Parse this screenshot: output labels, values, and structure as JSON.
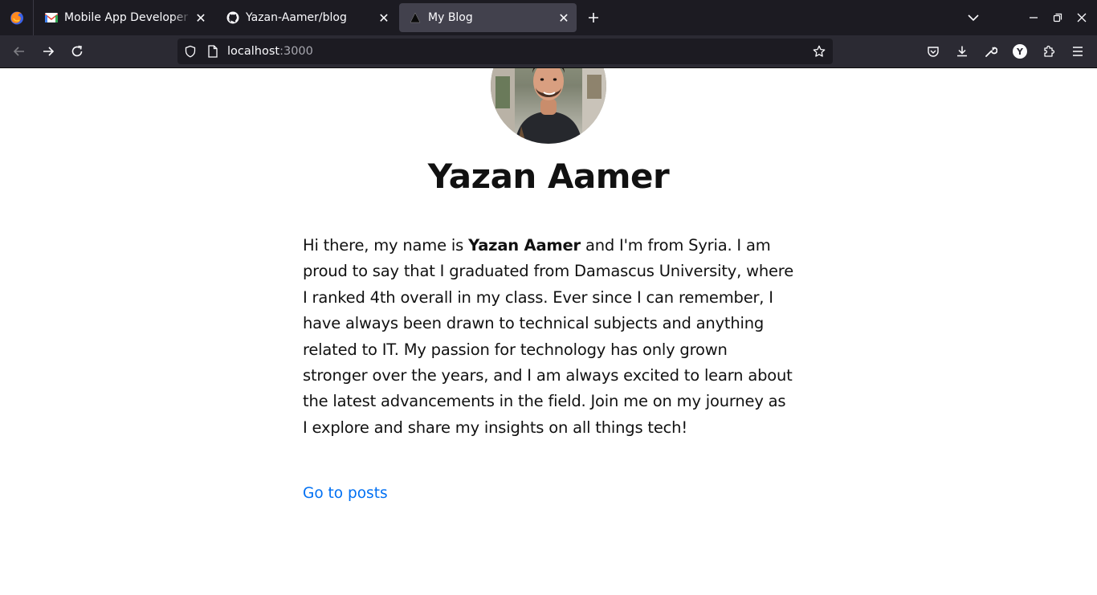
{
  "browser": {
    "tabs": [
      {
        "title": "Mobile App Developer As",
        "favicon": "gmail-icon",
        "active": false
      },
      {
        "title": "Yazan-Aamer/blog",
        "favicon": "github-icon",
        "active": false
      },
      {
        "title": "My Blog",
        "favicon": "triangle-icon",
        "active": true
      }
    ],
    "url": {
      "host": "localhost",
      "port": ":3000"
    },
    "profile_initial": "Y"
  },
  "page": {
    "name": "Yazan Aamer",
    "bio": {
      "intro": "Hi there, my name is ",
      "name_bold": "Yazan Aamer",
      "rest": " and I'm from Syria. I am proud to say that I graduated from Damascus University, where I ranked 4th overall in my class. Ever since I can remember, I have always been drawn to technical subjects and anything related to IT. My passion for technology has only grown stronger over the years, and I am always excited to learn about the latest advancements in the field. Join me on my journey as I explore and share my insights on all things tech!"
    },
    "posts_link": "Go to posts"
  },
  "colors": {
    "tabstrip_bg": "#1c1b22",
    "toolbar_bg": "#2b2a33",
    "active_tab_bg": "#42414d",
    "link": "#0070f3",
    "text": "#111111"
  }
}
